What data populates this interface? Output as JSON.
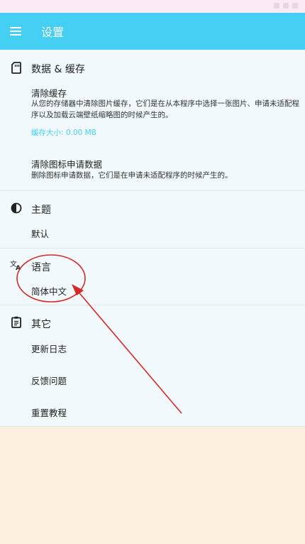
{
  "app_bar": {
    "title": "设置",
    "menu_icon": "menu-icon",
    "color": "#45cff3"
  },
  "sections": {
    "data_cache": {
      "icon": "sd-card-icon",
      "title": "数据 & 缓存",
      "clear_cache": {
        "title": "清除缓存",
        "description": "从您的存储器中清除图片缓存，它们是在从本程序中选择一张图片、申请未适配程序以及加载云端壁纸缩略图的时候产生的。",
        "cache_size_label": "缓存大小: 0.00 MB"
      },
      "clear_icon_requests": {
        "title": "清除图标申请数据",
        "description": "删除图标申请数据，它们是在申请未适配程序的时候产生的。"
      }
    },
    "theme": {
      "icon": "contrast-icon",
      "title": "主题",
      "value": "默认"
    },
    "language": {
      "icon": "translate-icon",
      "title": "语言",
      "value": "简体中文"
    },
    "other": {
      "icon": "clipboard-icon",
      "title": "其它",
      "items": [
        "更新日志",
        "反馈问题",
        "重置教程"
      ]
    }
  },
  "annotation": {
    "color": "#d42a2a",
    "description": "red circle around language setting with arrow"
  }
}
